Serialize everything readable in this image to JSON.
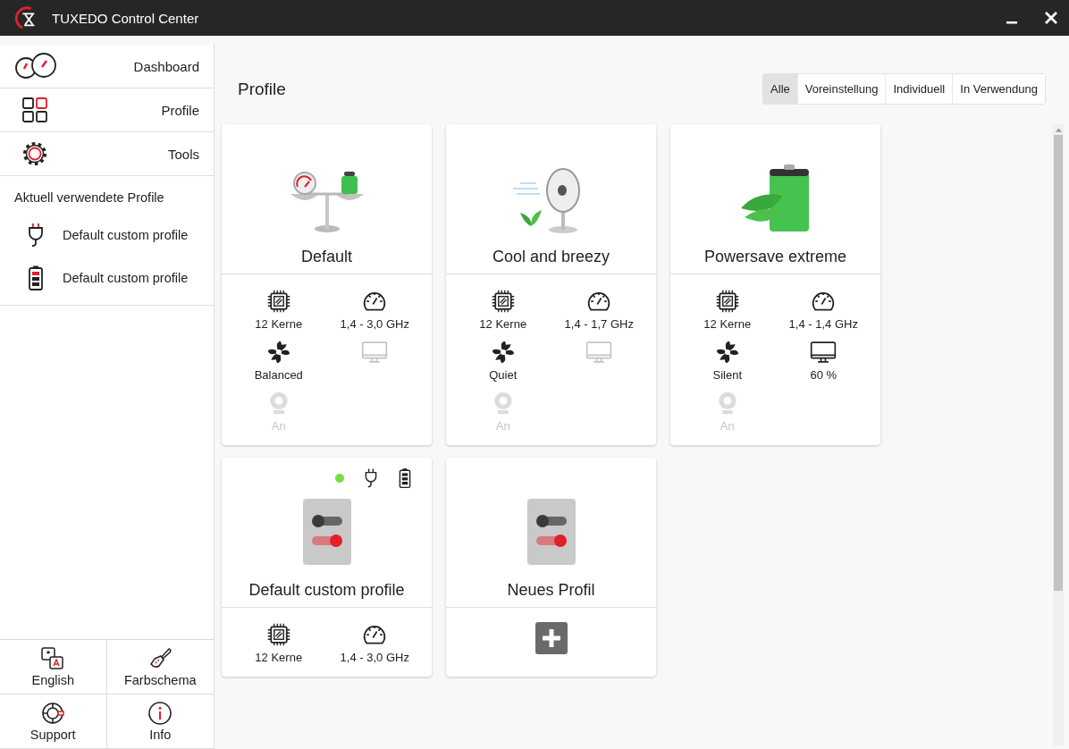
{
  "window": {
    "title": "TUXEDO Control Center"
  },
  "sidebar": {
    "nav": [
      {
        "label": "Dashboard",
        "kind": "dashboard"
      },
      {
        "label": "Profile",
        "kind": "profiles"
      },
      {
        "label": "Tools",
        "kind": "tools"
      }
    ],
    "active_heading": "Aktuell verwendete Profile",
    "active_profiles": [
      {
        "kind": "ac",
        "label": "Default custom profile"
      },
      {
        "kind": "battery",
        "label": "Default custom profile"
      }
    ],
    "bottom": [
      {
        "kind": "language",
        "label": "English"
      },
      {
        "kind": "colors",
        "label": "Farbschema"
      },
      {
        "kind": "support",
        "label": "Support"
      },
      {
        "kind": "info",
        "label": "Info"
      }
    ]
  },
  "page": {
    "title": "Profile",
    "filters": [
      {
        "label": "Alle",
        "selected": true
      },
      {
        "label": "Voreinstellung",
        "selected": false
      },
      {
        "label": "Individuell",
        "selected": false
      },
      {
        "label": "In Verwendung",
        "selected": false
      }
    ]
  },
  "profiles": [
    {
      "kind": "default",
      "name": "Default",
      "in_use": false,
      "specs": [
        {
          "kind": "cpu",
          "text": "12 Kerne",
          "disabled": false
        },
        {
          "kind": "clock",
          "text": "1,4 - 3,0 GHz",
          "disabled": false
        },
        {
          "kind": "fan",
          "text": "Balanced",
          "disabled": false
        },
        {
          "kind": "display",
          "disabled": true
        },
        {
          "kind": "webcam",
          "text": "An",
          "disabled": true
        }
      ]
    },
    {
      "kind": "cool",
      "name": "Cool and breezy",
      "in_use": false,
      "specs": [
        {
          "kind": "cpu",
          "text": "12 Kerne",
          "disabled": false
        },
        {
          "kind": "clock",
          "text": "1,4 - 1,7 GHz",
          "disabled": false
        },
        {
          "kind": "fan",
          "text": "Quiet",
          "disabled": false
        },
        {
          "kind": "display",
          "disabled": true
        },
        {
          "kind": "webcam",
          "text": "An",
          "disabled": true
        }
      ]
    },
    {
      "kind": "powersave",
      "name": "Powersave extreme",
      "in_use": false,
      "specs": [
        {
          "kind": "cpu",
          "text": "12 Kerne",
          "disabled": false
        },
        {
          "kind": "clock",
          "text": "1,4 - 1,4 GHz",
          "disabled": false
        },
        {
          "kind": "fan",
          "text": "Silent",
          "disabled": false
        },
        {
          "kind": "display",
          "text": "60 %",
          "disabled": false
        },
        {
          "kind": "webcam",
          "text": "An",
          "disabled": true
        }
      ]
    },
    {
      "kind": "custom",
      "name": "Default custom profile",
      "in_use": true,
      "color": "#76dd45",
      "specs": [
        {
          "kind": "cpu",
          "text": "12 Kerne",
          "disabled": false
        },
        {
          "kind": "clock",
          "text": "1,4 - 3,0 GHz",
          "disabled": false
        }
      ]
    },
    {
      "kind": "new",
      "name": "Neues Profil",
      "in_use": false
    }
  ]
}
